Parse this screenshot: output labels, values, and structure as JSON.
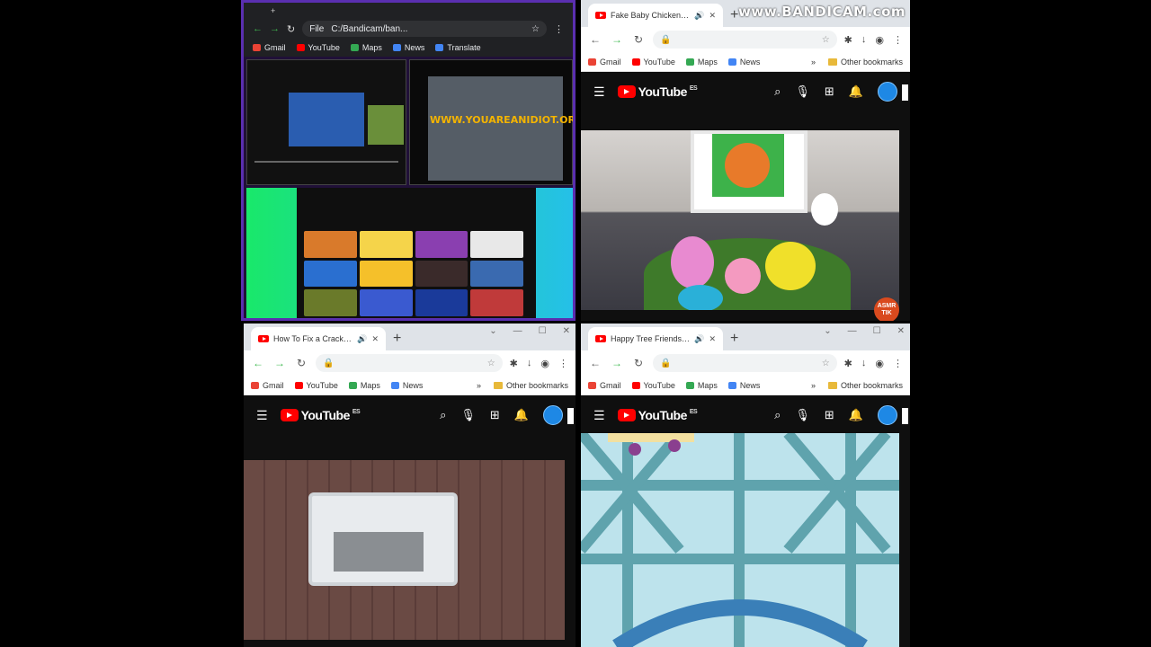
{
  "watermark": "www.BANDICAM.com",
  "top_left": {
    "url": "C:/Bandicam/ban...",
    "file_label": "File",
    "bookmarks": [
      "Gmail",
      "YouTube",
      "Maps",
      "News",
      "Translate"
    ],
    "nested_overlay_text": "WWW.YOUAREANIDIOT.ORG"
  },
  "top_right": {
    "tab_title": "Fake Baby Chicken for Easter",
    "bookmarks": [
      "Gmail",
      "YouTube",
      "Maps",
      "News"
    ],
    "other_bookmarks": "Other bookmarks",
    "yt_logo": "YouTube",
    "region": "ES",
    "channel_badge": "ASMR TIK"
  },
  "bottom_left": {
    "tab_title": "How To Fix a Cracked iPhone",
    "bookmarks": [
      "Gmail",
      "YouTube",
      "Maps",
      "News"
    ],
    "other_bookmarks": "Other bookmarks",
    "yt_logo": "YouTube",
    "region": "ES"
  },
  "bottom_right": {
    "tab_title": "Happy Tree Friends - One F",
    "bookmarks": [
      "Gmail",
      "YouTube",
      "Maps",
      "News"
    ],
    "other_bookmarks": "Other bookmarks",
    "yt_logo": "YouTube",
    "region": "ES"
  },
  "colors": {
    "youtube_red": "#ff0000",
    "nav_green": "#3fb950",
    "quadrant_border": "#5a2fb0"
  }
}
